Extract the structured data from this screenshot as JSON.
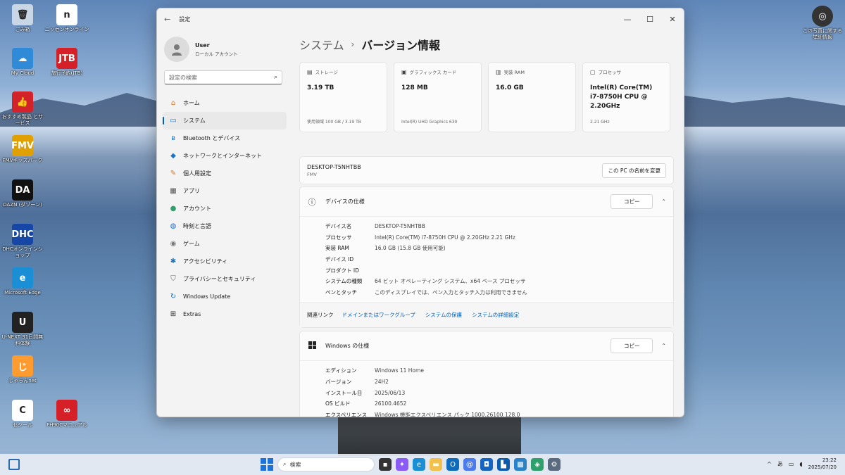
{
  "desktop": {
    "icons_left": [
      {
        "label": "ごみ箱",
        "glyph": "🗑",
        "color": "#c9d6e6"
      },
      {
        "label": "My Cloud",
        "glyph": "☁",
        "color": "#2f8bd7"
      },
      {
        "label": "おすすめ製品 とサービス",
        "glyph": "👍",
        "color": "#d2232a"
      },
      {
        "label": "FMVキッズパーク",
        "glyph": "FMV",
        "color": "#e0a000"
      },
      {
        "label": "DAZN (ダゾーン)",
        "glyph": "DA",
        "color": "#111111"
      },
      {
        "label": "DHCオンラインショップ",
        "glyph": "DHC",
        "color": "#1747a6"
      },
      {
        "label": "Microsoft Edge",
        "glyph": "e",
        "color": "#1a8fd6"
      },
      {
        "label": "U-NEXT 31日間無料体験",
        "glyph": "U",
        "color": "#222222"
      },
      {
        "label": "じゃらんnet",
        "glyph": "じ",
        "color": "#ff9b2f"
      },
      {
        "label": "セシール",
        "glyph": "C",
        "color": "#ffffff"
      }
    ],
    "icons_second": [
      {
        "label": "ニッセンオンライン",
        "glyph": "n",
        "color": "#ffffff"
      },
      {
        "label": "旅行予約(JTB)",
        "glyph": "JTB",
        "color": "#d42026"
      },
      {
        "label": "FH90Cマニュアル",
        "glyph": "∞",
        "color": "#d42026"
      }
    ],
    "top_right_icon": {
      "label": "この写真に関する 詳細情報",
      "glyph": "◎"
    }
  },
  "window": {
    "title": "設定",
    "controls": [
      "—",
      "☐",
      "✕"
    ],
    "user": {
      "name": "User",
      "account": "ローカル アカウント"
    },
    "search_placeholder": "設定の検索",
    "nav": [
      {
        "label": "ホーム",
        "icon": "home-icon",
        "glyph": "⌂",
        "color": "#e07b2a"
      },
      {
        "label": "システム",
        "icon": "display-icon",
        "glyph": "▭",
        "color": "#1a73c7",
        "selected": true
      },
      {
        "label": "Bluetooth とデバイス",
        "icon": "bluetooth-icon",
        "glyph": "ʙ",
        "color": "#1a73c7"
      },
      {
        "label": "ネットワークとインターネット",
        "icon": "wifi-icon",
        "glyph": "◆",
        "color": "#1a73c7"
      },
      {
        "label": "個人用設定",
        "icon": "brush-icon",
        "glyph": "✎",
        "color": "#d0772a"
      },
      {
        "label": "アプリ",
        "icon": "apps-icon",
        "glyph": "▦",
        "color": "#555555"
      },
      {
        "label": "アカウント",
        "icon": "person-icon",
        "glyph": "●",
        "color": "#2fa06b"
      },
      {
        "label": "時刻と言語",
        "icon": "globe-icon",
        "glyph": "◍",
        "color": "#1a73c7"
      },
      {
        "label": "ゲーム",
        "icon": "gamepad-icon",
        "glyph": "◉",
        "color": "#777777"
      },
      {
        "label": "アクセシビリティ",
        "icon": "accessibility-icon",
        "glyph": "✱",
        "color": "#1a73c7"
      },
      {
        "label": "プライバシーとセキュリティ",
        "icon": "shield-icon",
        "glyph": "⛉",
        "color": "#666666"
      },
      {
        "label": "Windows Update",
        "icon": "update-icon",
        "glyph": "↻",
        "color": "#1a73c7"
      },
      {
        "label": "Extras",
        "icon": "extras-icon",
        "glyph": "⊞",
        "color": "#333333"
      }
    ],
    "breadcrumb": {
      "parent": "システム",
      "sep": "›",
      "current": "バージョン情報"
    },
    "cards": [
      {
        "header": "ストレージ",
        "icon": "storage-icon",
        "glyph": "▤",
        "value": "3.19 TB",
        "sub": "使用領域 100 GB / 3.19 TB"
      },
      {
        "header": "グラフィックス カード",
        "icon": "gpu-icon",
        "glyph": "▣",
        "value": "128 MB",
        "sub": "Intel(R) UHD Graphics 630"
      },
      {
        "header": "実装 RAM",
        "icon": "ram-icon",
        "glyph": "▥",
        "value": "16.0 GB",
        "sub": ""
      },
      {
        "header": "プロセッサ",
        "icon": "cpu-icon",
        "glyph": "▢",
        "value": "Intel(R) Core(TM) i7-8750H CPU @ 2.20GHz",
        "sub": "2.21 GHz"
      }
    ],
    "pc": {
      "name": "DESKTOP-T5NHTBB",
      "model": "FMV",
      "rename_label": "この PC の名前を変更"
    },
    "device_specs": {
      "title": "デバイスの仕様",
      "copy_label": "コピー",
      "rows": [
        {
          "k": "デバイス名",
          "v": "DESKTOP-T5NHTBB"
        },
        {
          "k": "プロセッサ",
          "v": "Intel(R) Core(TM) i7-8750H CPU @ 2.20GHz   2.21 GHz"
        },
        {
          "k": "実装 RAM",
          "v": "16.0 GB (15.8 GB 使用可能)"
        },
        {
          "k": "デバイス ID",
          "v": ""
        },
        {
          "k": "プロダクト ID",
          "v": ""
        },
        {
          "k": "システムの種類",
          "v": "64 ビット オペレーティング システム、x64 ベース プロセッサ"
        },
        {
          "k": "ペンとタッチ",
          "v": "このディスプレイでは、ペン入力とタッチ入力は利用できません"
        }
      ]
    },
    "related": {
      "label": "関連リンク",
      "links": [
        "ドメインまたはワークグループ",
        "システムの保護",
        "システムの詳細設定"
      ]
    },
    "windows_specs": {
      "title": "Windows の仕様",
      "copy_label": "コピー",
      "rows": [
        {
          "k": "エディション",
          "v": "Windows 11 Home"
        },
        {
          "k": "バージョン",
          "v": "24H2"
        },
        {
          "k": "インストール日",
          "v": "2025/06/13"
        },
        {
          "k": "OS ビルド",
          "v": "26100.4652"
        },
        {
          "k": "エクスペリエンス",
          "v": "Windows 機能エクスペリエンス パック 1000.26100.128.0"
        }
      ]
    }
  },
  "taskbar": {
    "search_label": "検索",
    "apps": [
      {
        "name": "taskview-icon",
        "glyph": "▪",
        "color": "#333333"
      },
      {
        "name": "copilot-icon",
        "glyph": "✦",
        "color": "#8a5cf5"
      },
      {
        "name": "edge-icon",
        "glyph": "e",
        "color": "#1a8fd6"
      },
      {
        "name": "folder-icon",
        "glyph": "▬",
        "color": "#f2c04c"
      },
      {
        "name": "outlook-icon",
        "glyph": "O",
        "color": "#0f6cbd"
      },
      {
        "name": "mail-icon",
        "glyph": "@",
        "color": "#4b7bec"
      },
      {
        "name": "store-icon",
        "glyph": "◘",
        "color": "#1565c0"
      },
      {
        "name": "app-icon",
        "glyph": "▙",
        "color": "#0b5cad"
      },
      {
        "name": "photos-icon",
        "glyph": "▩",
        "color": "#2a83c9"
      },
      {
        "name": "app2-icon",
        "glyph": "◈",
        "color": "#2fa06b"
      },
      {
        "name": "settings-icon",
        "glyph": "⚙",
        "color": "#5a6b80"
      }
    ],
    "tray": {
      "chevron": "^",
      "ime": "あ",
      "time": "23:22",
      "date": "2025/07/20"
    }
  }
}
